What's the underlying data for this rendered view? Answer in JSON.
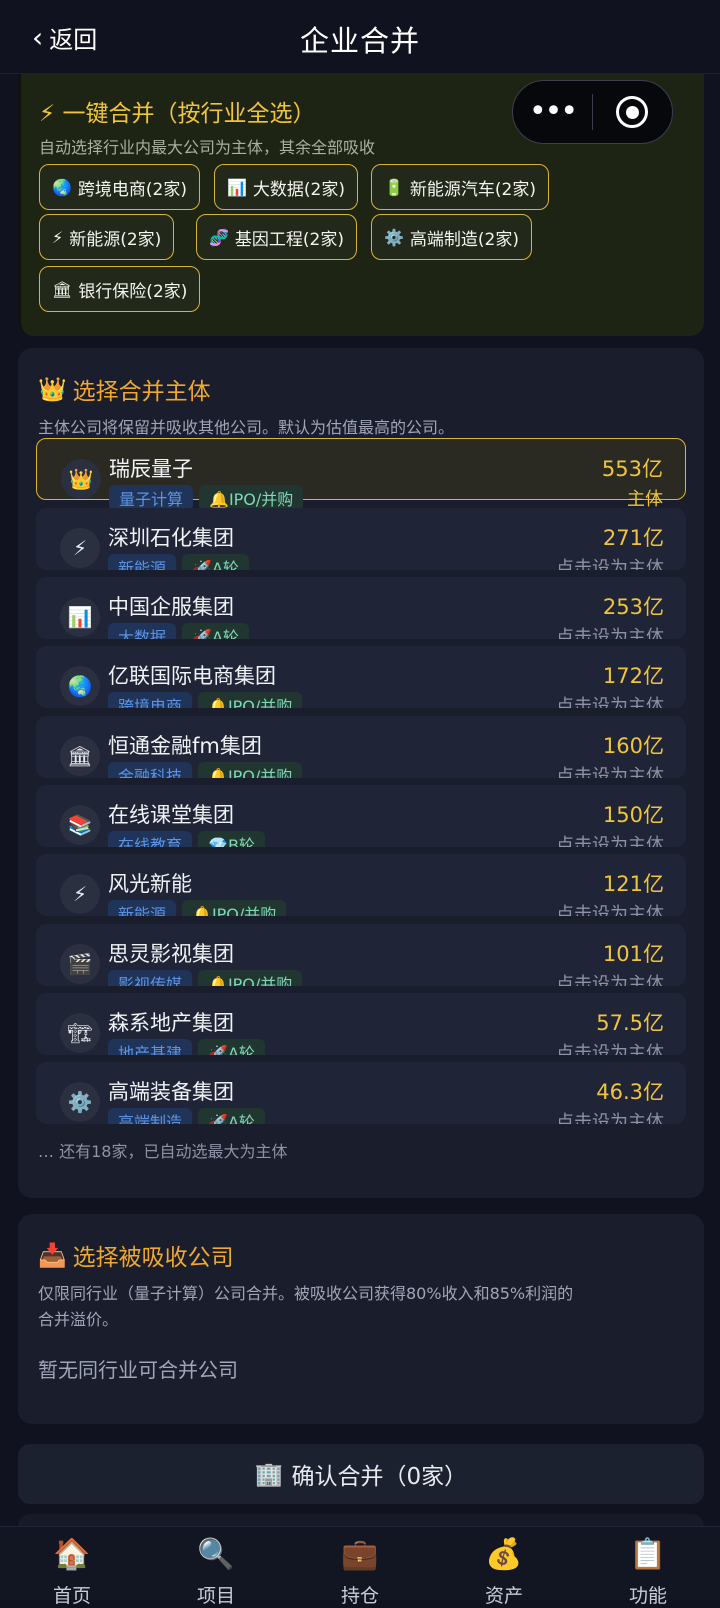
{
  "nav": {
    "back_label": "返回",
    "title": "企业合并"
  },
  "quick": {
    "title": "⚡ 一键合并（按行业全选）",
    "subtitle": "自动选择行业内最大公司为主体，其余全部吸收",
    "chips": [
      {
        "icon": "🌏",
        "label": "跨境电商(2家)"
      },
      {
        "icon": "📊",
        "label": "大数据(2家)"
      },
      {
        "icon": "🔋",
        "label": "新能源汽车(2家)"
      },
      {
        "icon": "⚡",
        "label": "新能源(2家)"
      },
      {
        "icon": "🧬",
        "label": "基因工程(2家)"
      },
      {
        "icon": "⚙️",
        "label": "高端制造(2家)"
      },
      {
        "icon": "🏛",
        "label": "银行保险(2家)"
      }
    ]
  },
  "main": {
    "title": "选择合并主体",
    "subtitle": "主体公司将保留并吸收其他公司。默认为估值最高的公司。",
    "companies": [
      {
        "icon": "👑",
        "name": "瑞辰量子",
        "industry": "量子计算",
        "stage": "🔔IPO/并购",
        "value": "553亿",
        "action": "主体"
      },
      {
        "icon": "⚡",
        "name": "深圳石化集团",
        "industry": "新能源",
        "stage": "🚀A轮",
        "value": "271亿",
        "action": "点击设为主体"
      },
      {
        "icon": "📊",
        "name": "中国企服集团",
        "industry": "大数据",
        "stage": "🚀A轮",
        "value": "253亿",
        "action": "点击设为主体"
      },
      {
        "icon": "🌏",
        "name": "亿联国际电商集团",
        "industry": "跨境电商",
        "stage": "🔔IPO/并购",
        "value": "172亿",
        "action": "点击设为主体"
      },
      {
        "icon": "🏛",
        "name": "恒通金融fm集团",
        "industry": "金融科技",
        "stage": "🔔IPO/并购",
        "value": "160亿",
        "action": "点击设为主体"
      },
      {
        "icon": "📚",
        "name": "在线课堂集团",
        "industry": "在线教育",
        "stage": "💎B轮",
        "value": "150亿",
        "action": "点击设为主体"
      },
      {
        "icon": "⚡",
        "name": "风光新能",
        "industry": "新能源",
        "stage": "🔔IPO/并购",
        "value": "121亿",
        "action": "点击设为主体"
      },
      {
        "icon": "🎬",
        "name": "思灵影视集团",
        "industry": "影视传媒",
        "stage": "🔔IPO/并购",
        "value": "101亿",
        "action": "点击设为主体"
      },
      {
        "icon": "🏗",
        "name": "森系地产集团",
        "industry": "地产基建",
        "stage": "🚀A轮",
        "value": "57.5亿",
        "action": "点击设为主体"
      },
      {
        "icon": "⚙️",
        "name": "高端装备集团",
        "industry": "高端制造",
        "stage": "🚀A轮",
        "value": "46.3亿",
        "action": "点击设为主体"
      }
    ],
    "more_note": "… 还有18家，已自动选最大为主体"
  },
  "absorb": {
    "title": "选择被吸收公司",
    "subtitle_line1": "仅限同行业（量子计算）公司合并。被吸收公司获得80%收入和85%利润的",
    "subtitle_line2": "合并溢价。",
    "empty": "暂无同行业可合并公司"
  },
  "confirm_label": "确认合并（0家）",
  "tabbar": [
    {
      "icon": "🏠",
      "label": "首页"
    },
    {
      "icon": "🔍",
      "label": "项目"
    },
    {
      "icon": "💼",
      "label": "持仓"
    },
    {
      "icon": "💰",
      "label": "资产"
    },
    {
      "icon": "📋",
      "label": "功能"
    }
  ]
}
